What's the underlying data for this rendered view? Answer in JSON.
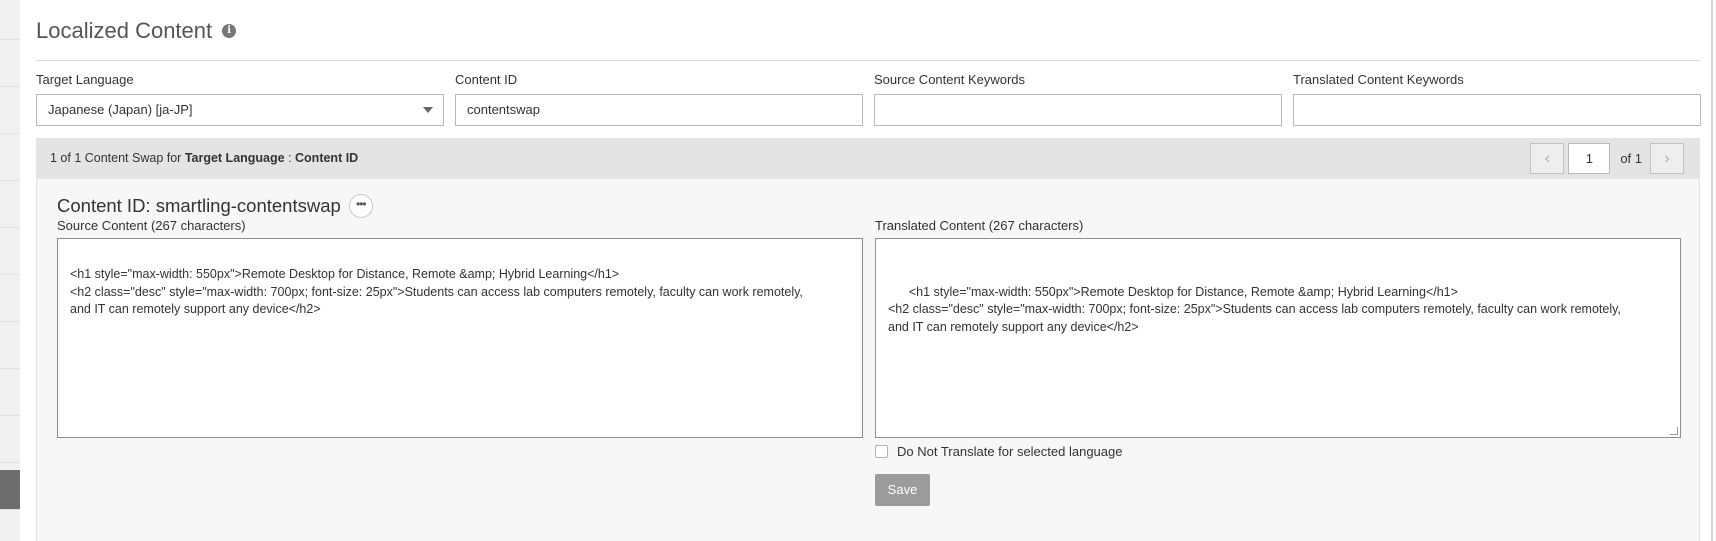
{
  "page": {
    "title": "Localized Content",
    "info_icon": "info-icon"
  },
  "filters": {
    "target_language": {
      "label": "Target Language",
      "value": "Japanese (Japan) [ja-JP]"
    },
    "content_id": {
      "label": "Content ID",
      "value": "contentswap"
    },
    "source_keywords": {
      "label": "Source Content Keywords",
      "value": ""
    },
    "translated_keywords": {
      "label": "Translated Content Keywords",
      "value": ""
    }
  },
  "results_bar": {
    "summary_prefix": "1 of 1 Content Swap for ",
    "target_language_bold": "Target Language",
    "separator": " : ",
    "content_id_bold": "Content ID",
    "pager": {
      "prev_icon": "chevron-left-icon",
      "page": "1",
      "of_label": "of 1",
      "next_icon": "chevron-right-icon"
    }
  },
  "content_item": {
    "title": "Content ID: smartling-contentswap",
    "more_icon": "ellipsis-icon",
    "source_label": "Source Content (267 characters)",
    "source_text": "<h1 style=\"max-width: 550px\">Remote Desktop for Distance, Remote &amp; Hybrid Learning</h1>\n<h2 class=\"desc\" style=\"max-width: 700px; font-size: 25px\">Students can access lab computers remotely, faculty can work remotely,\nand IT can remotely support any device</h2>",
    "translated_label": "Translated Content (267 characters)",
    "translated_text": "<h1 style=\"max-width: 550px\">Remote Desktop for Distance, Remote &amp; Hybrid Learning</h1>\n<h2 class=\"desc\" style=\"max-width: 700px; font-size: 25px\">Students can access lab computers remotely, faculty can work remotely,\nand IT can remotely support any device</h2>",
    "do_not_translate_label": "Do Not Translate for selected language",
    "do_not_translate_checked": false,
    "save_label": "Save"
  },
  "colors": {
    "bar_background": "#e4e4e4",
    "panel_background": "#f7f7f7",
    "save_button": "#9c9c9c",
    "rail_active": "#6d6d6d"
  }
}
